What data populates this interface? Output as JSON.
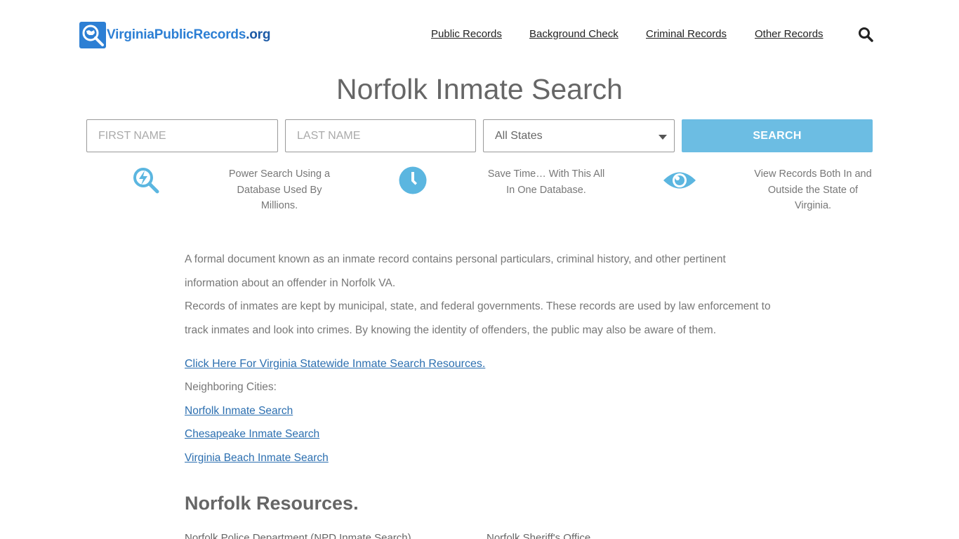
{
  "header": {
    "logo_text_part1": "VirginiaPublicRecords",
    "logo_text_part2": ".org",
    "nav": [
      "Public Records",
      "Background Check",
      "Criminal Records",
      "Other Records"
    ]
  },
  "page_title": "Norfolk Inmate Search",
  "search_form": {
    "first_name_placeholder": "FIRST NAME",
    "last_name_placeholder": "LAST NAME",
    "state_selected": "All States",
    "button_label": "SEARCH"
  },
  "features": [
    {
      "icon": "power-search-icon",
      "line1": "Power Search Using a",
      "line2": "Database Used By",
      "line3": "Millions."
    },
    {
      "icon": "clock-icon",
      "line1": "Save Time… With This All",
      "line2": "In One Database.",
      "line3": ""
    },
    {
      "icon": "eye-icon",
      "line1": "View Records Both In and",
      "line2": "Outside the State of",
      "line3": "Virginia."
    }
  ],
  "intro": {
    "p1": "A formal document known as an inmate record contains personal particulars, criminal history, and other pertinent information about an offender in Norfolk VA.",
    "p2": "Records of inmates are kept by municipal, state, and federal governments. These records are used by law enforcement to track inmates and look into crimes. By knowing the identity of offenders, the public may also be aware of them."
  },
  "statewide_link": "Click Here For Virginia Statewide Inmate Search Resources.",
  "neighboring_label": "Neighboring Cities:",
  "neighboring_links": [
    "Norfolk Inmate Search",
    "Chesapeake Inmate Search",
    "Virginia Beach Inmate Search"
  ],
  "resources": {
    "title": "Norfolk Resources.",
    "items": [
      "Norfolk Police Department (NPD Inmate Search)",
      "Norfolk Sheriff's Office"
    ]
  },
  "colors": {
    "accent": "#6cbde3",
    "logo_blue": "#2c7fd4",
    "link": "#2c6fb0"
  }
}
